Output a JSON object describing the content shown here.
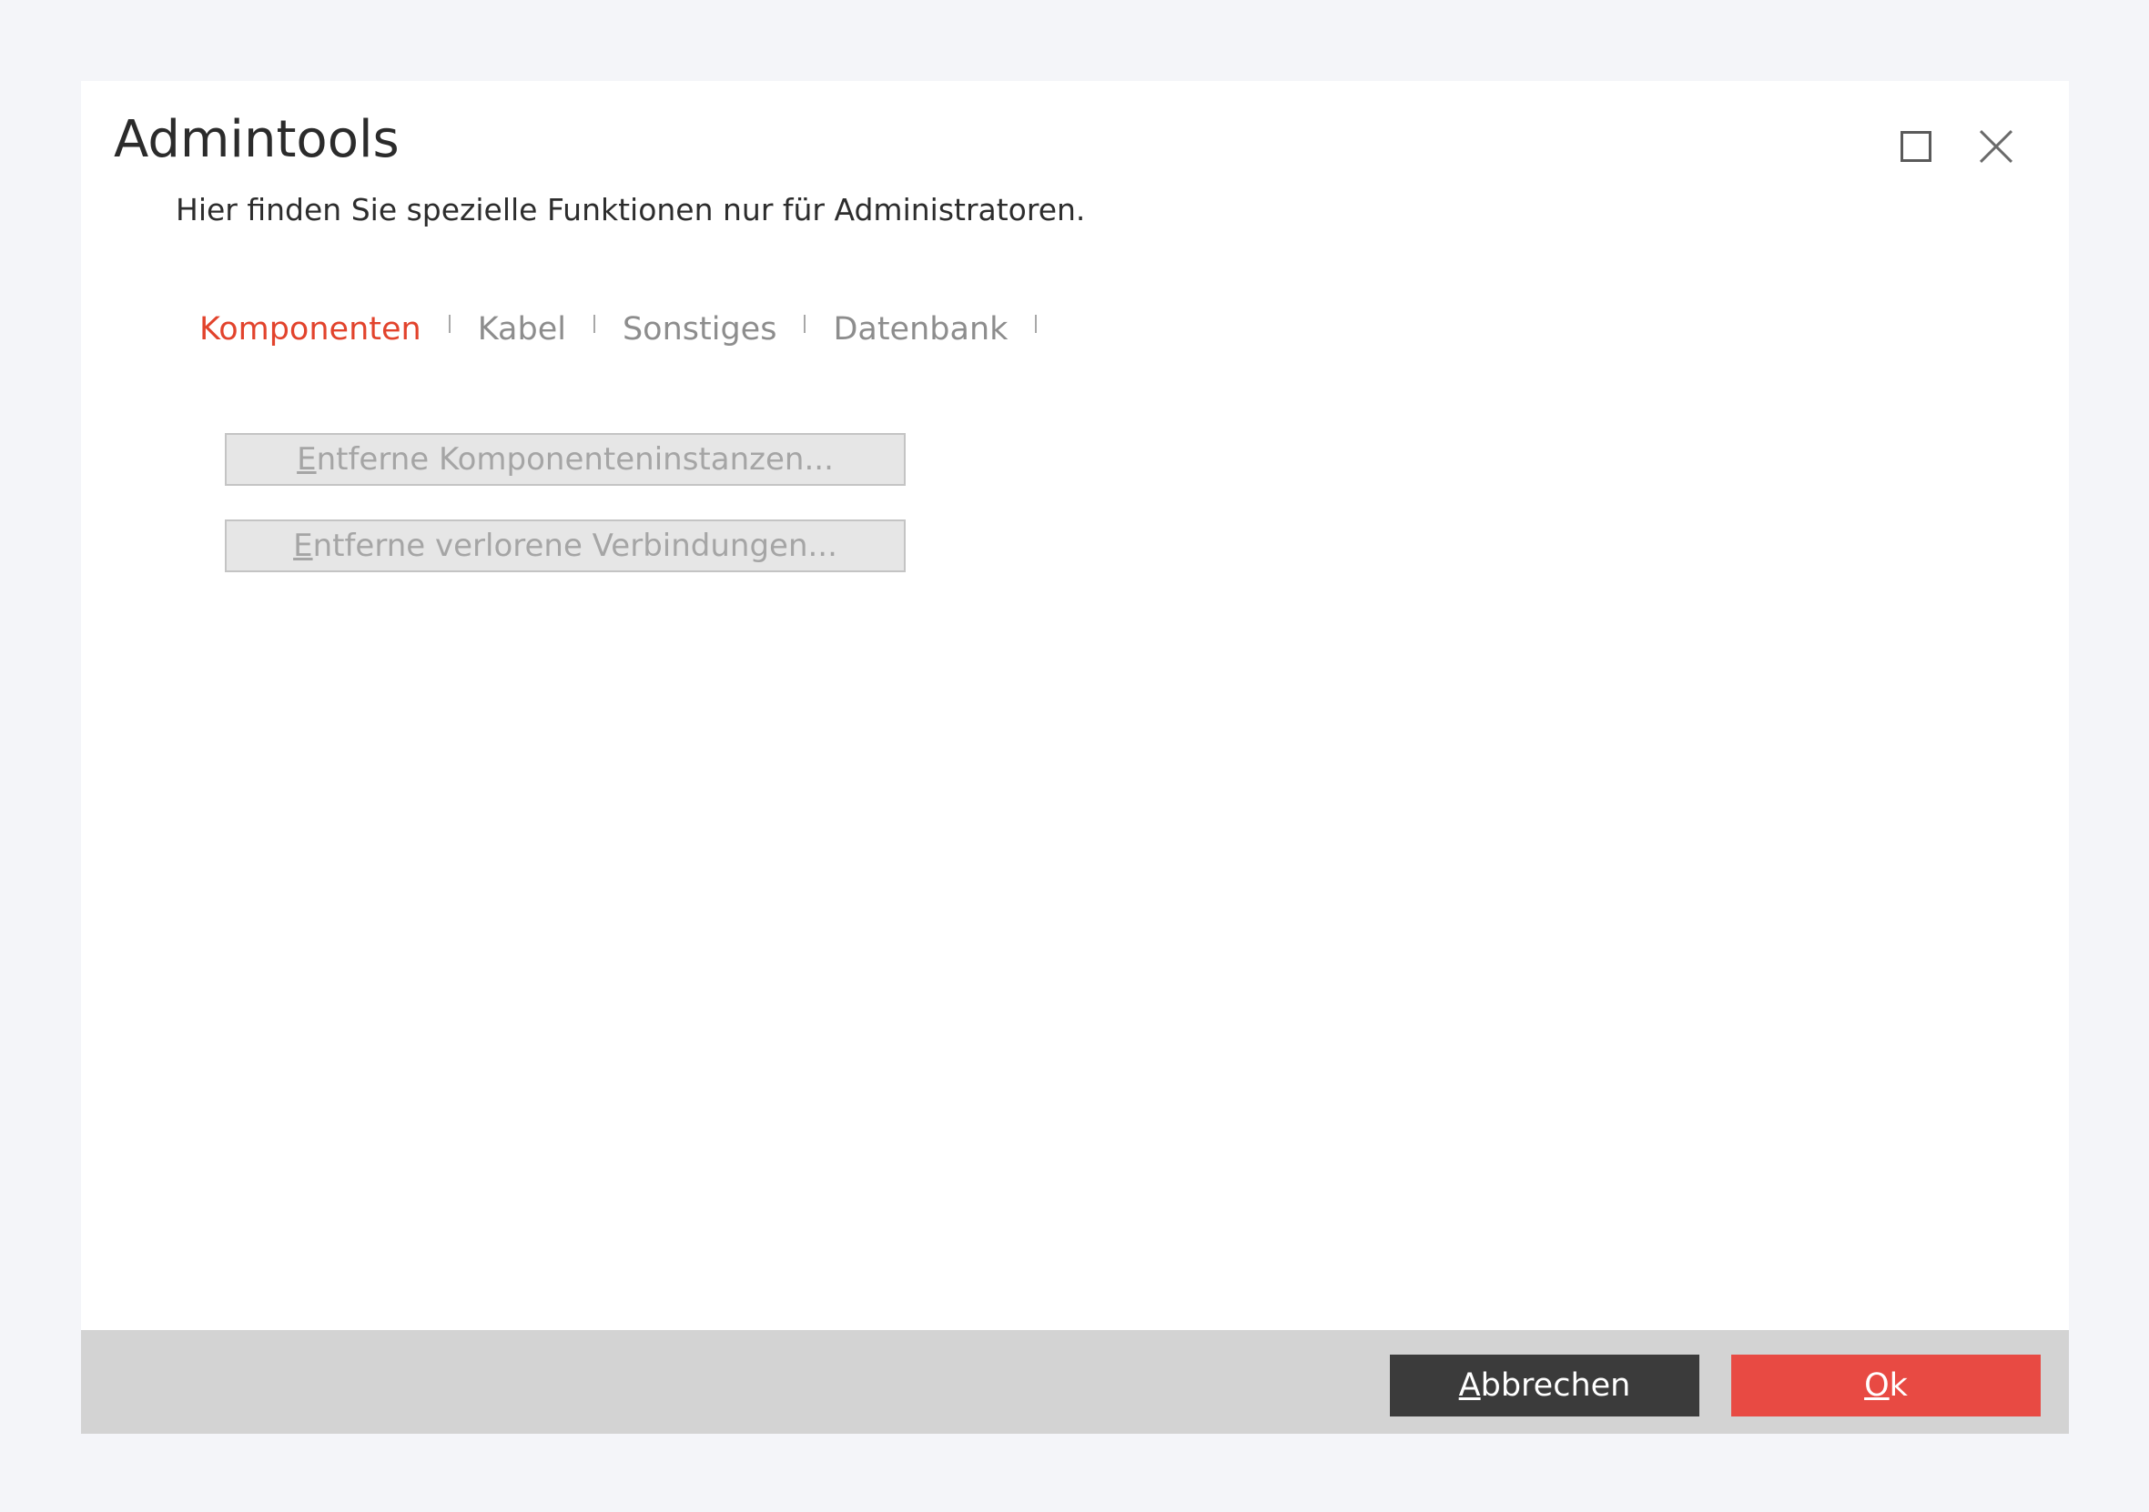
{
  "window": {
    "title": "Admintools",
    "subtitle": "Hier finden Sie spezielle Funktionen nur für Administratoren."
  },
  "tabs": [
    {
      "label": "Komponenten",
      "active": true
    },
    {
      "label": "Kabel",
      "active": false
    },
    {
      "label": "Sonstiges",
      "active": false
    },
    {
      "label": "Datenbank",
      "active": false
    }
  ],
  "actions": {
    "remove_instances": {
      "mnemonic": "E",
      "rest": "ntferne Komponenteninstanzen...",
      "enabled": false
    },
    "remove_lost": {
      "mnemonic": "E",
      "rest": "ntferne verlorene Verbindungen...",
      "enabled": false
    }
  },
  "footer": {
    "cancel": {
      "mnemonic": "A",
      "rest": "bbrechen"
    },
    "ok": {
      "mnemonic": "O",
      "rest": "k"
    }
  },
  "colors": {
    "accent": "#e2432c",
    "ok_button": "#e84a43",
    "cancel_button": "#3b3b3b",
    "footer_bar": "#d3d3d3",
    "background": "#f4f5f9"
  },
  "icons": {
    "maximize": "maximize-icon",
    "close": "close-icon"
  }
}
